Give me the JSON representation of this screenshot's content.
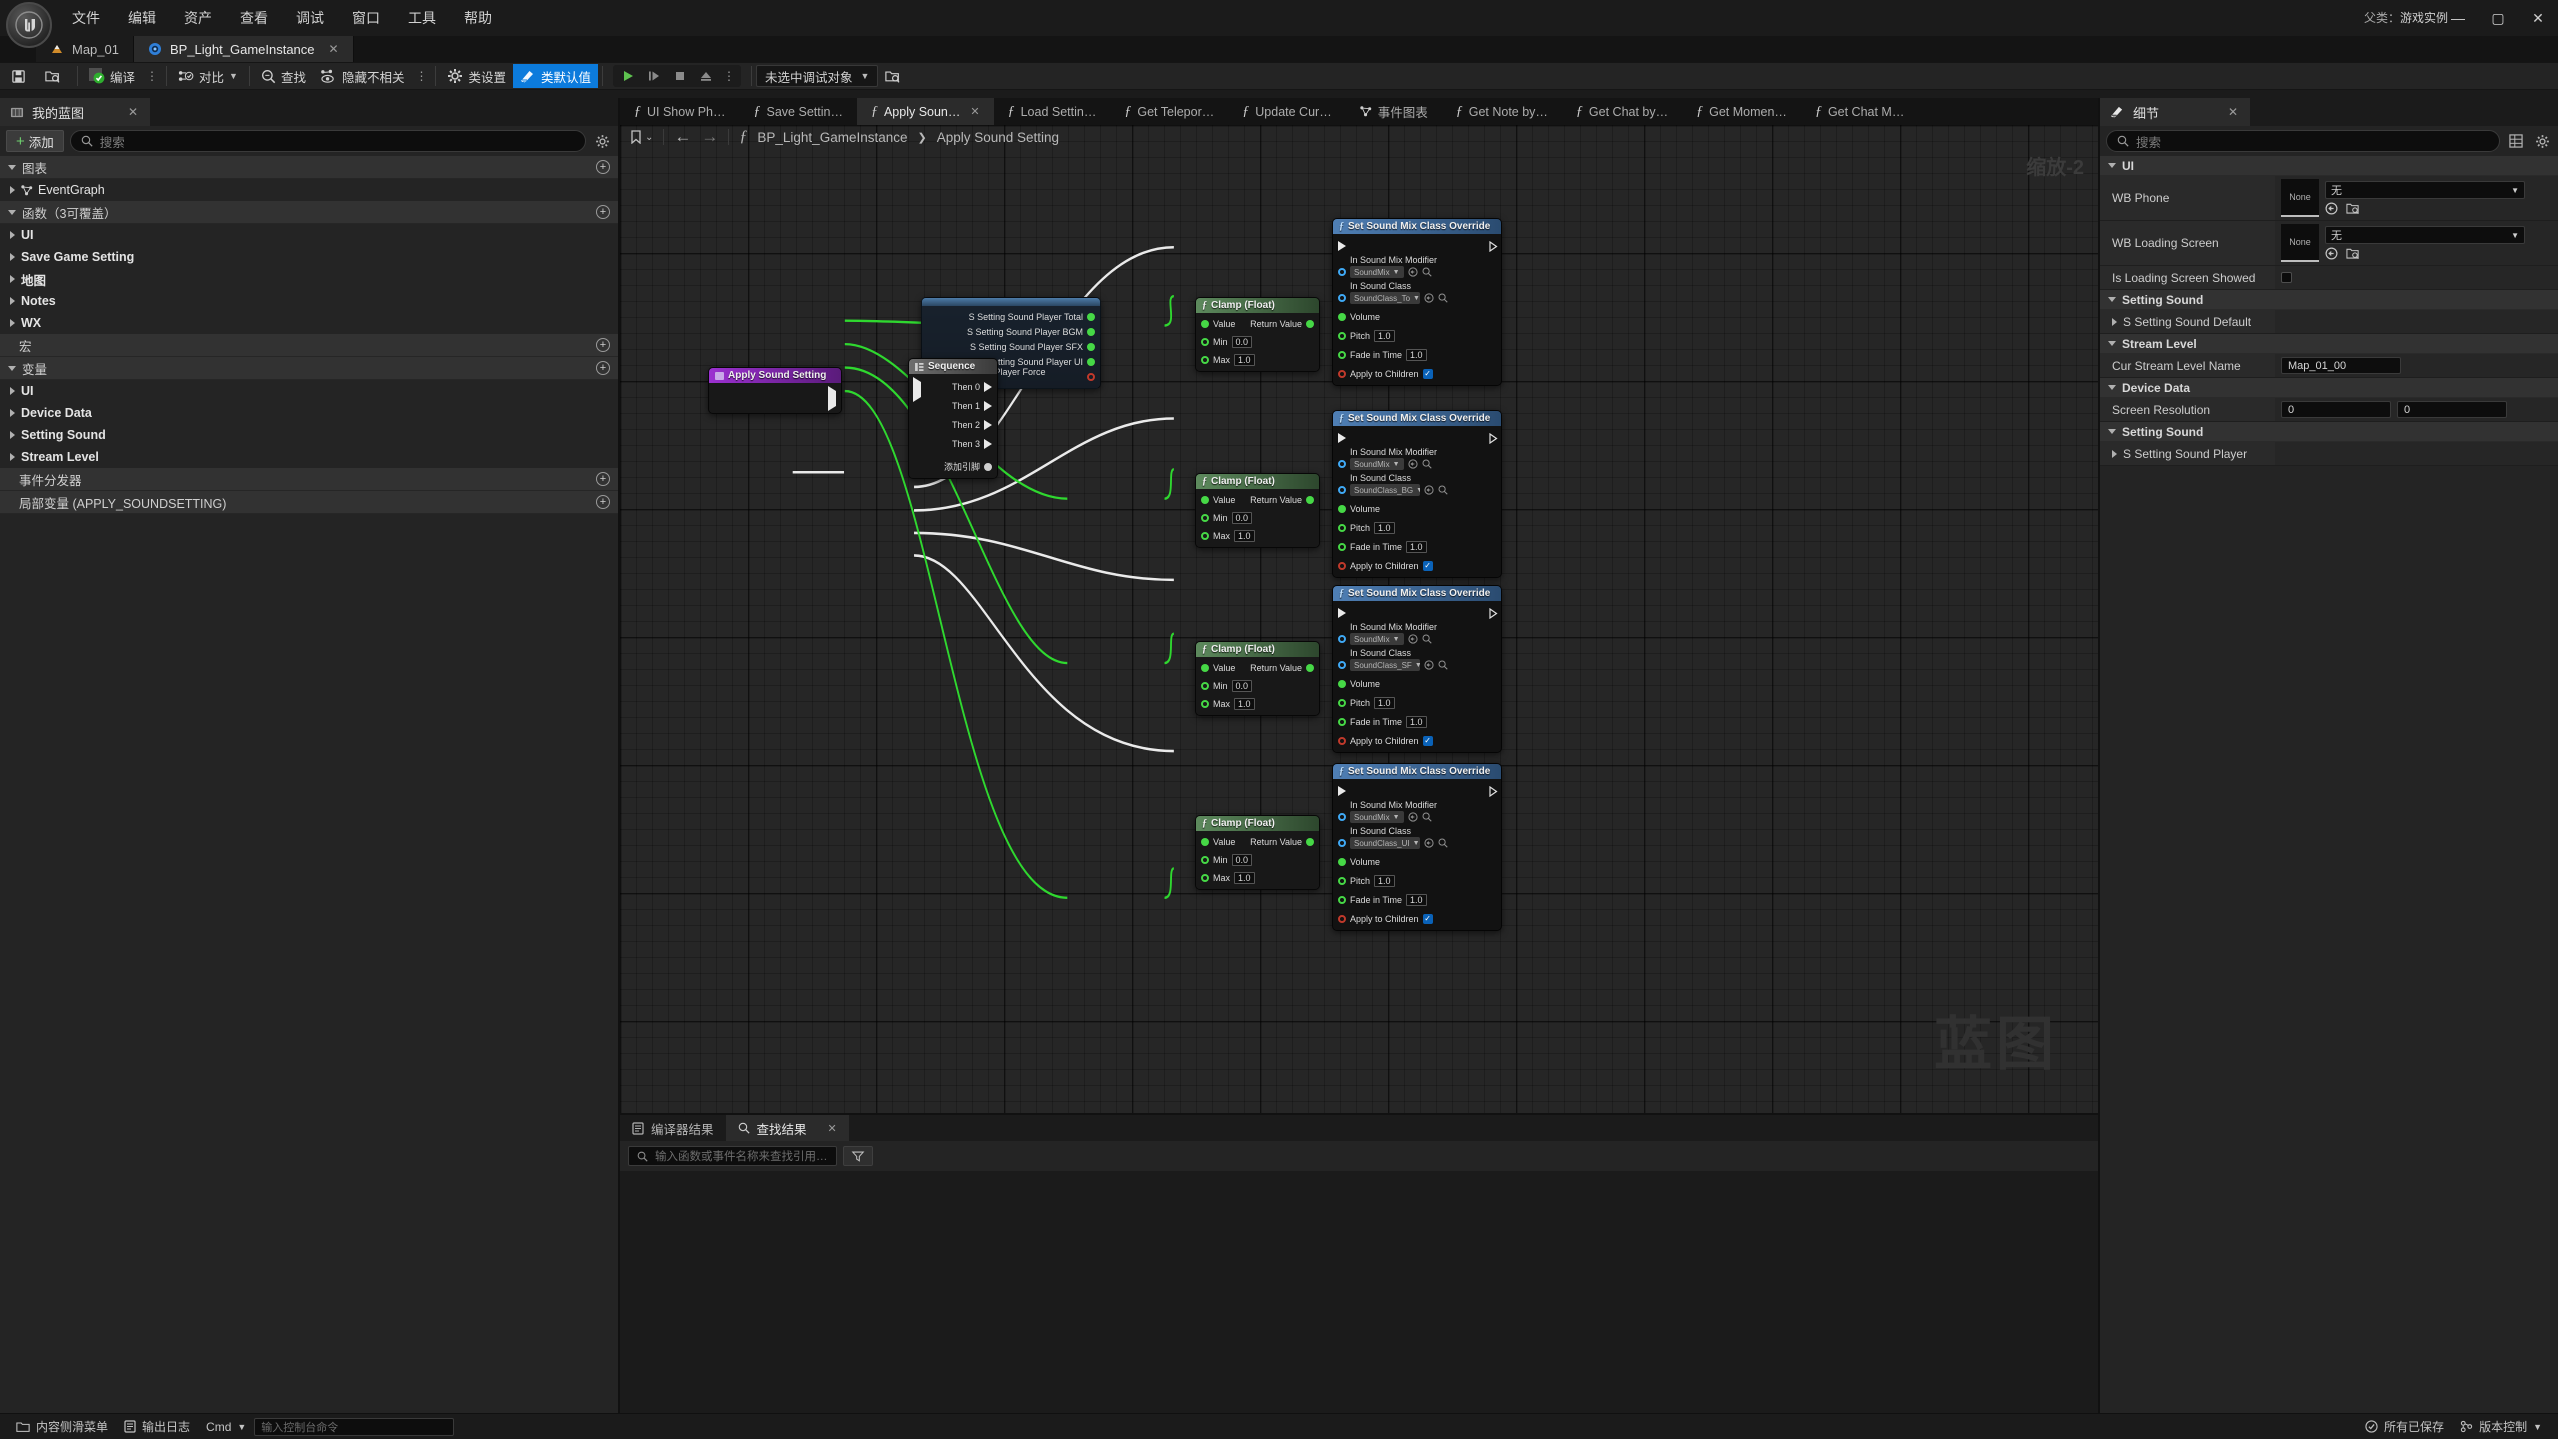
{
  "window": {
    "project_label": "父类：",
    "project_value": "游戏实例",
    "minimize": "—",
    "maximize": "▢",
    "close": "✕"
  },
  "menu": [
    "文件",
    "编辑",
    "资产",
    "查看",
    "调试",
    "窗口",
    "工具",
    "帮助"
  ],
  "asset_tabs": [
    {
      "label": "Map_01",
      "icon": "level-icon",
      "active": false,
      "closable": false
    },
    {
      "label": "BP_Light_GameInstance",
      "icon": "blueprint-icon",
      "active": true,
      "closable": true,
      "close": "✕"
    }
  ],
  "toolbar": {
    "save_label": "",
    "browse_label": "",
    "compile_label": "编译",
    "diff_label": "对比",
    "find_label": "查找",
    "hide_unrelated_label": "隐藏不相关",
    "class_settings_label": "类设置",
    "class_defaults_label": "类默认值",
    "kebab": "⋮",
    "debug_object": "未选中调试对象",
    "accent_color": "#0c7bdc"
  },
  "my_blueprint": {
    "tab_title": "我的蓝图",
    "tab_close": "✕",
    "add_label": "添加",
    "search_placeholder": "搜索",
    "sections": [
      {
        "title": "图表",
        "open": true,
        "items": [
          {
            "label": "EventGraph",
            "icon": "graph-icon",
            "bold": false
          }
        ]
      },
      {
        "title": "函数（3可覆盖）",
        "open": true,
        "items": [
          {
            "label": "UI",
            "bold": true
          },
          {
            "label": "Save Game Setting",
            "bold": true
          },
          {
            "label": "地图",
            "bold": true
          },
          {
            "label": "Notes",
            "bold": true
          },
          {
            "label": "WX",
            "bold": true
          }
        ]
      },
      {
        "title": "宏",
        "open": false,
        "items": []
      },
      {
        "title": "变量",
        "open": true,
        "items": [
          {
            "label": "UI",
            "bold": true
          },
          {
            "label": "Device Data",
            "bold": true
          },
          {
            "label": "Setting Sound",
            "bold": true
          },
          {
            "label": "Stream Level",
            "bold": true
          }
        ]
      },
      {
        "title": "事件分发器",
        "open": false,
        "items": []
      },
      {
        "title": "局部变量 (APPLY_SOUNDSETTING)",
        "open": false,
        "items": []
      }
    ]
  },
  "graph_tabs": [
    {
      "label": "UI Show Ph…",
      "active": false
    },
    {
      "label": "Save Settin…",
      "active": false
    },
    {
      "label": "Apply Soun…",
      "active": true,
      "close": "✕"
    },
    {
      "label": "Load Settin…",
      "active": false
    },
    {
      "label": "Get Telepor…",
      "active": false
    },
    {
      "label": "Update Cur…",
      "active": false
    },
    {
      "label": "事件图表",
      "active": false,
      "icon": "graph-icon"
    },
    {
      "label": "Get Note by…",
      "active": false
    },
    {
      "label": "Get Chat by…",
      "active": false
    },
    {
      "label": "Get Momen…",
      "active": false
    },
    {
      "label": "Get Chat M…",
      "active": false
    }
  ],
  "breadcrumb": {
    "root": "BP_Light_GameInstance",
    "separator": "❯",
    "current": "Apply Sound Setting",
    "back": "←",
    "forward": "→",
    "fx": "ƒ",
    "bookmark_caret": "⌄"
  },
  "canvas": {
    "zoom_label": "缩放-2",
    "watermark": "蓝图"
  },
  "nodes": {
    "entry": {
      "title": "Apply Sound Setting",
      "color": "#8a2be2"
    },
    "sequence": {
      "title": "Sequence",
      "pins": [
        "Then 0",
        "Then 1",
        "Then 2",
        "Then 3"
      ],
      "add_pin": "添加引脚"
    },
    "variables": [
      "S Setting Sound Player Total",
      "S Setting Sound Player BGM",
      "S Setting Sound Player SFX",
      "S Setting Sound Player UI",
      "S Setting Sound Player Force Feedback"
    ],
    "clamp": {
      "title": "Clamp (Float)",
      "value_label": "Value",
      "return_label": "Return Value",
      "min_label": "Min",
      "min_value": "0.0",
      "max_label": "Max",
      "max_value": "1.0"
    },
    "clamp_instances": [
      {
        "min": "0.0",
        "max": "1.0"
      },
      {
        "min": "0.0",
        "max": "1.0"
      },
      {
        "min": "0.0",
        "max": "1.0"
      },
      {
        "min": "0.0",
        "max": "1.0"
      }
    ],
    "setmix": {
      "title": "Set Sound Mix Class Override",
      "mix_label": "In Sound Mix Modifier",
      "class_label": "In Sound Class",
      "volume_label": "Volume",
      "pitch_label": "Pitch",
      "pitch_value": "1.0",
      "fade_label": "Fade in Time",
      "fade_value": "1.0",
      "children_label": "Apply to Children",
      "check": "✓"
    },
    "setmix_instances": [
      {
        "mix": "SoundMix",
        "class": "SoundClass_To"
      },
      {
        "mix": "SoundMix",
        "class": "SoundClass_BG"
      },
      {
        "mix": "SoundMix",
        "class": "SoundClass_SF"
      },
      {
        "mix": "SoundMix",
        "class": "SoundClass_UI"
      }
    ]
  },
  "bottom_panel": {
    "tabs": [
      {
        "label": "编译器结果",
        "icon": "compiler-icon",
        "active": false
      },
      {
        "label": "查找结果",
        "icon": "search-icon",
        "active": true,
        "close": "✕"
      }
    ],
    "find_placeholder": "输入函数或事件名称来查找引用…"
  },
  "details": {
    "tab_title": "细节",
    "tab_close": "✕",
    "search_placeholder": "搜索",
    "sections": [
      {
        "title": "UI",
        "rows": [
          {
            "key": "WB Phone",
            "type": "asset",
            "thumb": "None",
            "combo": "无"
          },
          {
            "key": "WB Loading Screen",
            "type": "asset",
            "thumb": "None",
            "combo": "无"
          },
          {
            "key": "Is Loading Screen Showed",
            "type": "checkbox",
            "checked": false
          }
        ]
      },
      {
        "title": "Setting Sound",
        "rows": [
          {
            "key": "S Setting Sound Default",
            "type": "expand"
          }
        ]
      },
      {
        "title": "Stream Level",
        "rows": [
          {
            "key": "Cur Stream Level Name",
            "type": "text",
            "value": "Map_01_00"
          }
        ]
      },
      {
        "title": "Device Data",
        "rows": [
          {
            "key": "Screen Resolution",
            "type": "vec2",
            "x": "0",
            "y": "0"
          }
        ]
      },
      {
        "title": "Setting Sound",
        "rows": [
          {
            "key": "S Setting Sound Player",
            "type": "expand"
          }
        ]
      }
    ]
  },
  "status_bar": {
    "content_drawer": "内容侧滑菜单",
    "output_log": "输出日志",
    "cmd_label": "Cmd",
    "cmd_placeholder": "输入控制台命令",
    "all_saved": "所有已保存",
    "source_control": "版本控制"
  }
}
